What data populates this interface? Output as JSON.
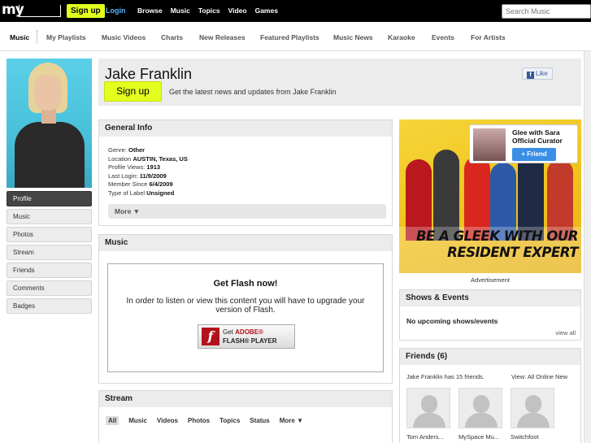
{
  "topbar": {
    "logo": "my",
    "signup": "Sign up",
    "login": "Login",
    "nav": [
      "Browse",
      "Music",
      "Topics",
      "Video",
      "Games"
    ],
    "search_placeholder": "Search Music"
  },
  "subnav": {
    "items": [
      "Music",
      "My Playlists",
      "Music Videos",
      "Charts",
      "New Releases",
      "Featured Playlists",
      "Music News",
      "Karaoke",
      "Events",
      "For Artists"
    ],
    "active": "Music"
  },
  "profile": {
    "name": "Jake Franklin",
    "signup": "Sign up",
    "tagline": "Get the latest news and updates from Jake Franklin",
    "like": "Like"
  },
  "sidenav": [
    "Profile",
    "Music",
    "Photos",
    "Stream",
    "Friends",
    "Comments",
    "Badges"
  ],
  "general_info": {
    "title": "General Info",
    "fields": [
      {
        "label": "Genre:",
        "value": "Other"
      },
      {
        "label": "Location",
        "value": "AUSTIN, Texas, US"
      },
      {
        "label": "Profile Views:",
        "value": "1913"
      },
      {
        "label": "Last Login:",
        "value": "11/9/2009"
      },
      {
        "label": "Member Since",
        "value": "6/4/2009"
      },
      {
        "label": "Type of Label",
        "value": "Unsigned"
      }
    ],
    "more": "More ▼"
  },
  "music": {
    "title": "Music",
    "flash_title": "Get Flash now!",
    "flash_text": "In order to listen or view this content you will have to upgrade your version of Flash.",
    "flash_btn_1": "Get",
    "flash_btn_adobe": "ADOBE®",
    "flash_btn_2": "FLASH® PLAYER"
  },
  "stream": {
    "title": "Stream",
    "tabs": [
      "All",
      "Music",
      "Videos",
      "Photos",
      "Topics",
      "Status",
      "More ▼"
    ]
  },
  "ad": {
    "curator_name": "Glee with Sara Official Curator",
    "friend_btn": "+ Friend",
    "headline_1": "BE A GLEEK WITH OUR",
    "headline_2": "RESIDENT EXPERT",
    "label": "Advertisement"
  },
  "shows": {
    "title": "Shows & Events",
    "empty": "No upcoming shows/events",
    "view_all": "view all"
  },
  "friends": {
    "title": "Friends (6)",
    "count_text": "Jake Franklin has 15 friends.",
    "view_text": "View:  All  Online  New",
    "list": [
      "Tom Anders...",
      "MySpace Mu...",
      "Switchfoot"
    ]
  }
}
